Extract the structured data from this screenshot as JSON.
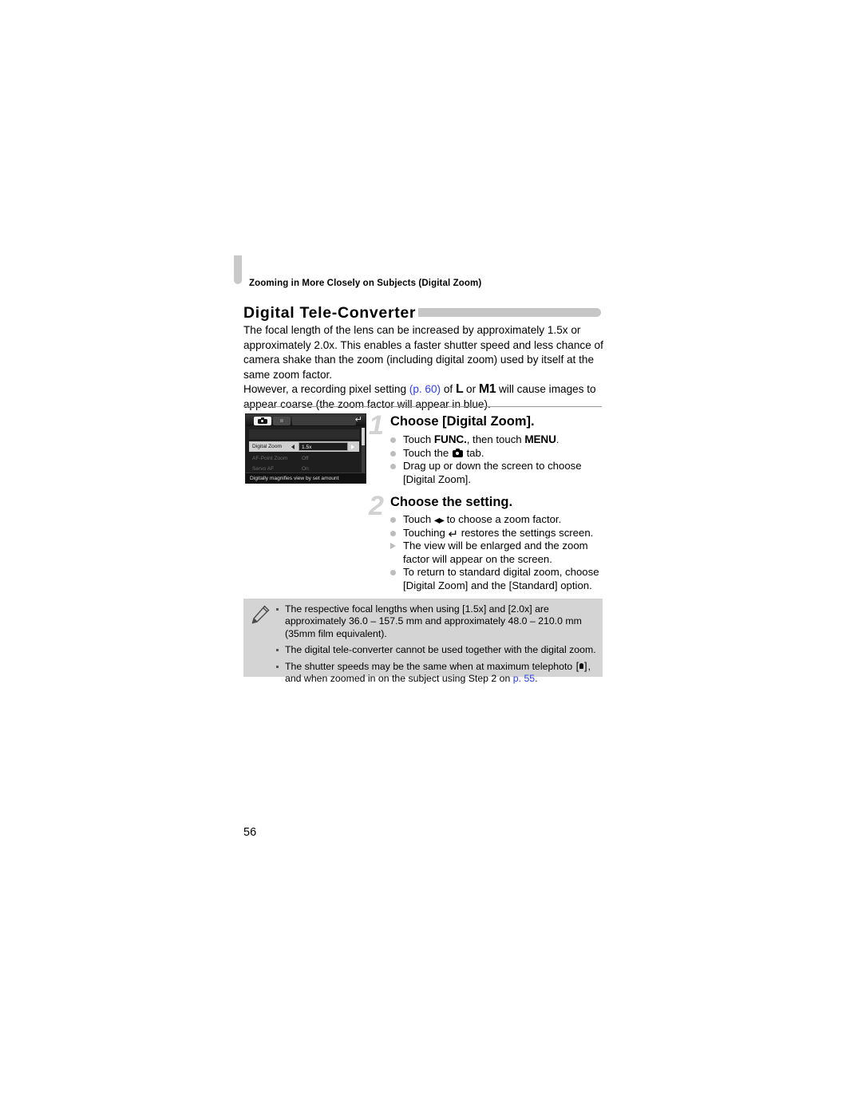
{
  "page": {
    "running_header": "Zooming in More Closely on Subjects (Digital Zoom)",
    "folio": "56"
  },
  "section": {
    "title": "Digital Tele-Converter",
    "intro_paragraph_1": "The focal length of the lens can be increased by approximately 1.5x or approximately 2.0x. This enables a faster shutter speed and less chance of camera shake than the zoom (including digital zoom) used by itself at the same zoom factor.",
    "intro_p2_before_link": "However, a recording pixel setting ",
    "intro_p2_link": "(p. 60)",
    "intro_p2_mid": " of ",
    "intro_p2_glyph_L": "L",
    "intro_p2_or": " or ",
    "intro_p2_glyph_M1": "M1",
    "intro_p2_after": " will cause images to appear coarse (the zoom factor will appear in blue)."
  },
  "screenshot": {
    "tab_camera_icon": "camera-icon",
    "tab_tools_label": "ıı",
    "back_icon": "return-arrow-icon",
    "rows": [
      {
        "label": "Digital Zoom",
        "value": "1.5x",
        "selected": true
      },
      {
        "label": "AF-Point Zoom",
        "value": "Off",
        "selected": false
      },
      {
        "label": "Servo AF",
        "value": "On",
        "selected": false
      }
    ],
    "footer_hint": "Digitally magnifies view by set amount"
  },
  "steps": [
    {
      "number": "1",
      "heading": "Choose [Digital Zoom].",
      "items": [
        {
          "marker": "dot",
          "before": "Touch ",
          "kbd1": "FUNC.",
          "mid": ", then touch ",
          "kbd2": "MENU",
          "after": "."
        },
        {
          "marker": "dot",
          "before": "Touch the ",
          "icon": "camera-icon",
          "after": " tab."
        },
        {
          "marker": "dot",
          "before": "Drag up or down the screen to choose [Digital Zoom]."
        }
      ]
    },
    {
      "number": "2",
      "heading": "Choose the setting.",
      "items": [
        {
          "marker": "dot",
          "before": "Touch ",
          "icon": "left-right-arrows-icon",
          "after": " to choose a zoom factor."
        },
        {
          "marker": "dot",
          "before": "Touching ",
          "icon": "return-arrow-icon",
          "after": " restores the settings screen."
        },
        {
          "marker": "triangle",
          "before": "The view will be enlarged and the zoom factor will appear on the screen."
        },
        {
          "marker": "dot",
          "before": "To return to standard digital zoom, choose [Digital Zoom] and the [Standard] option."
        }
      ]
    }
  ],
  "note": {
    "icon": "pencil-icon",
    "items": [
      {
        "text": "The respective focal lengths when using [1.5x] and [2.0x] are approximately 36.0 – 157.5 mm and approximately 48.0 – 210.0 mm (35mm film equivalent)."
      },
      {
        "text": "The digital tele-converter cannot be used together with the digital zoom."
      },
      {
        "before": "The shutter speeds may be the same when at maximum telephoto ",
        "icon": "telephoto-icon",
        "mid": ", and when zoomed in on the subject using Step 2 on ",
        "link": "p. 55",
        "after": "."
      }
    ]
  },
  "colors": {
    "link": "#2b3fe8",
    "note_background": "#d4d4d4",
    "title_rule": "#c6c6c6",
    "step_number": "#d2d2d2"
  }
}
